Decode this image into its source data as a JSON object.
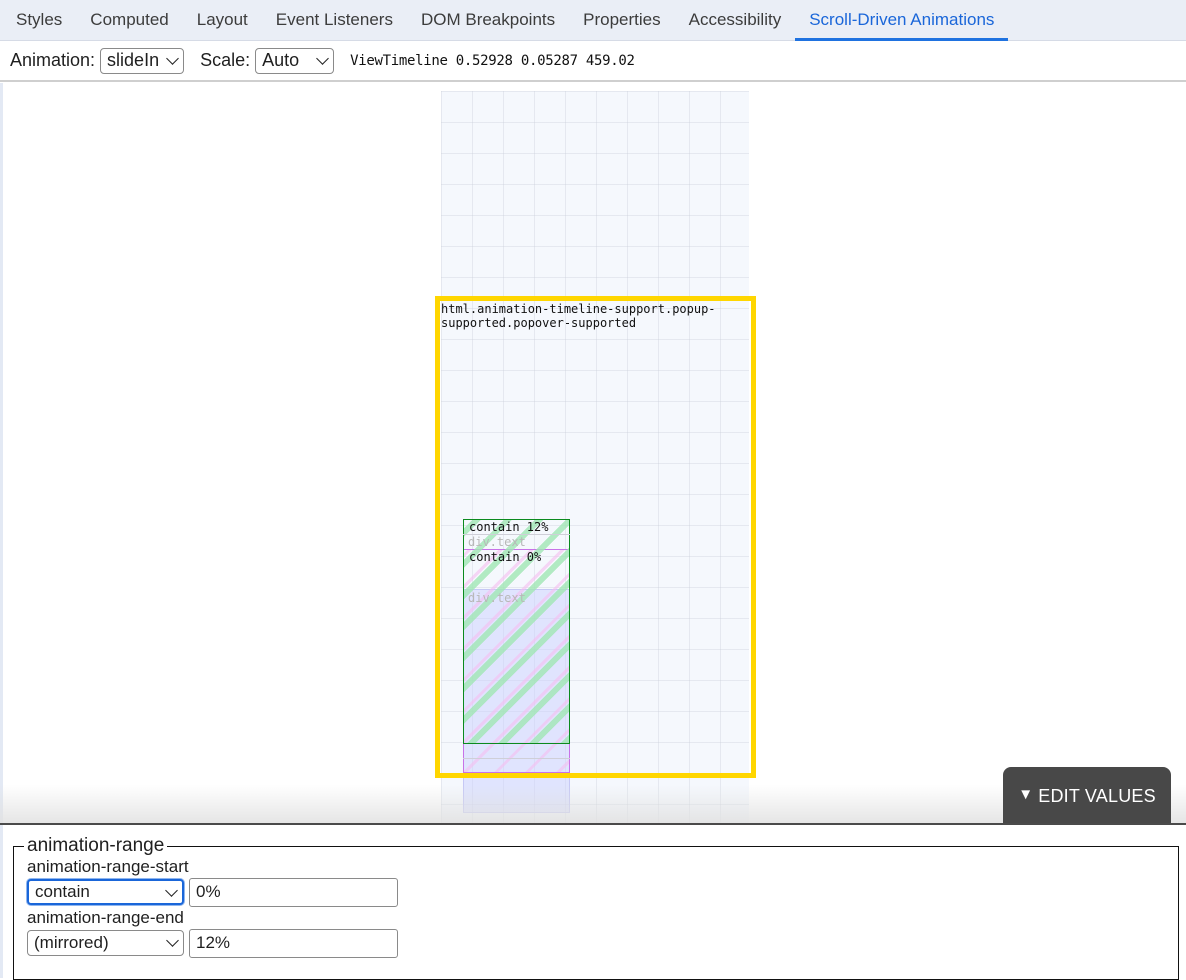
{
  "tabs": [
    {
      "label": "Styles",
      "active": false
    },
    {
      "label": "Computed",
      "active": false
    },
    {
      "label": "Layout",
      "active": false
    },
    {
      "label": "Event Listeners",
      "active": false
    },
    {
      "label": "DOM Breakpoints",
      "active": false
    },
    {
      "label": "Properties",
      "active": false
    },
    {
      "label": "Accessibility",
      "active": false
    },
    {
      "label": "Scroll-Driven Animations",
      "active": true
    }
  ],
  "toolbar": {
    "animation_label": "Animation:",
    "animation_value": "slideIn",
    "scale_label": "Scale:",
    "scale_value": "Auto",
    "timeline_readout": "ViewTimeline 0.52928 0.05287 459.02"
  },
  "visualization": {
    "subject_label": "html.animation-timeline-support.popup-supported.popover-supported",
    "range_end_label": "contain 12%",
    "range_start_label": "contain 0%",
    "target_label_1": "div.text",
    "target_label_2": "div.text",
    "colors": {
      "subject_border": "#ffd600",
      "range_green": "#0b8a1e",
      "range_pink": "#c872e8",
      "target_blue": "#c6c8f5"
    }
  },
  "edit_values_button": {
    "icon": "triangle-down-icon",
    "label": "EDIT VALUES"
  },
  "panel": {
    "legend": "animation-range",
    "start": {
      "label": "animation-range-start",
      "select_value": "contain",
      "input_value": "0%"
    },
    "end": {
      "label": "animation-range-end",
      "select_value": "(mirrored)",
      "input_value": "12%"
    }
  }
}
